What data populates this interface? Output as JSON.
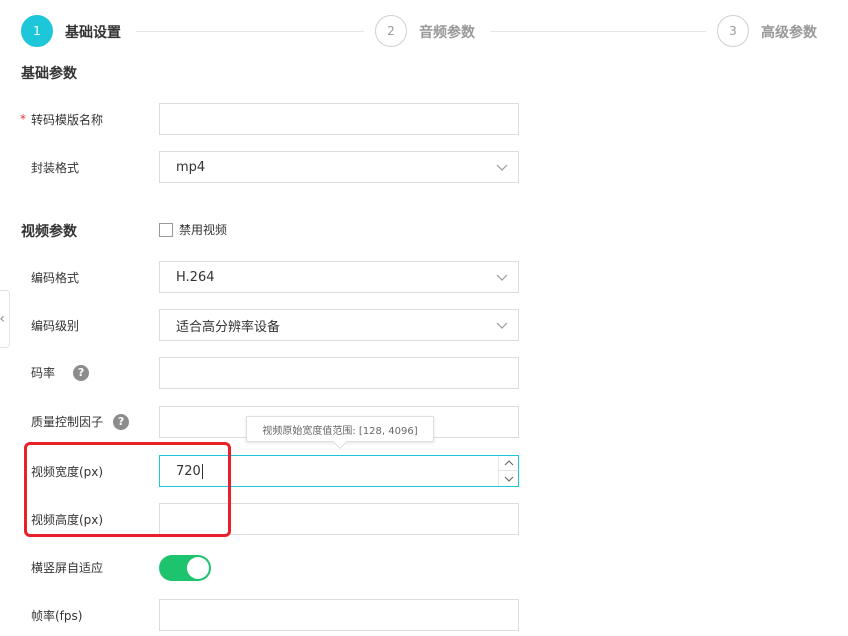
{
  "steps": [
    {
      "number": "1",
      "label": "基础设置",
      "active": true
    },
    {
      "number": "2",
      "label": "音频参数",
      "active": false
    },
    {
      "number": "3",
      "label": "高级参数",
      "active": false
    }
  ],
  "basic": {
    "title": "基础参数",
    "template_name": {
      "required_mark": "*",
      "label": "转码模版名称",
      "value": ""
    },
    "container": {
      "label": "封装格式",
      "value": "mp4"
    }
  },
  "video": {
    "title": "视频参数",
    "disable_video_label": "禁用视频",
    "codec": {
      "label": "编码格式",
      "value": "H.264"
    },
    "profile": {
      "label": "编码级别",
      "value": "适合高分辨率设备"
    },
    "bitrate": {
      "label": "码率",
      "help": "?",
      "value": ""
    },
    "crf": {
      "label": "质量控制因子",
      "help": "?",
      "value": ""
    },
    "width": {
      "label": "视频宽度(px)",
      "value": "720"
    },
    "height": {
      "label": "视频高度(px)",
      "value": ""
    },
    "adaptive": {
      "label": "横竖屏自适应",
      "on": true
    },
    "fps": {
      "label": "帧率(fps)",
      "value": ""
    },
    "tooltip": "视频原始宽度值范围: [128, 4096]"
  },
  "side_handle_glyph": "‹",
  "colors": {
    "accent": "#1dc6d9",
    "toggle_on": "#1ec46d",
    "highlight": "#e8202a",
    "required": "#e53935"
  }
}
